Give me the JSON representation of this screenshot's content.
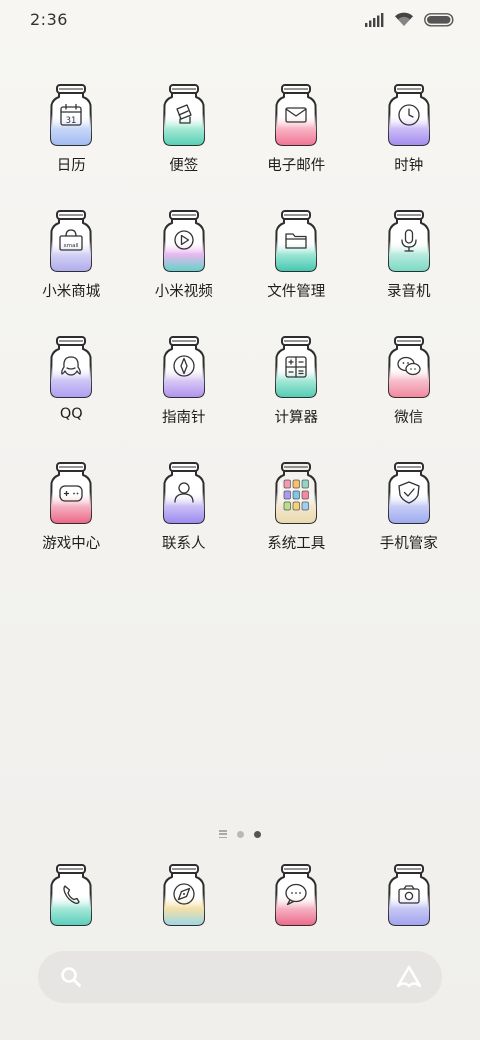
{
  "status_bar": {
    "time": "2:36"
  },
  "apps": [
    {
      "label": "日历",
      "icon": "calendar-icon",
      "glyph": "cal",
      "liquid": [
        "#ffffff",
        "#c8d8f8",
        "#9cb6f2"
      ]
    },
    {
      "label": "便签",
      "icon": "note-icon",
      "glyph": "note",
      "liquid": [
        "#ffffff",
        "#a9ead6",
        "#4ccbb0"
      ]
    },
    {
      "label": "电子邮件",
      "icon": "mail-icon",
      "glyph": "mail",
      "liquid": [
        "#ffffff",
        "#f8b5c6",
        "#f06a8c"
      ]
    },
    {
      "label": "时钟",
      "icon": "clock-icon",
      "glyph": "clock",
      "liquid": [
        "#ffffff",
        "#cdbff6",
        "#9c84ee"
      ]
    },
    {
      "label": "小米商城",
      "icon": "mall-icon",
      "glyph": "mall",
      "liquid": [
        "#ffffff",
        "#d4d2f5",
        "#aaa6ec"
      ]
    },
    {
      "label": "小米视频",
      "icon": "video-icon",
      "glyph": "video",
      "liquid": [
        "#ffffff",
        "#e9b8f0",
        "#4dd6c0"
      ]
    },
    {
      "label": "文件管理",
      "icon": "folder-icon",
      "glyph": "folder",
      "liquid": [
        "#ffffff",
        "#9fe6d7",
        "#34c2a8"
      ]
    },
    {
      "label": "录音机",
      "icon": "microphone-icon",
      "glyph": "mic",
      "liquid": [
        "#ffffff",
        "#b9eadf",
        "#6fd8bd"
      ]
    },
    {
      "label": "QQ",
      "icon": "qq-penguin-icon",
      "glyph": "qq",
      "liquid": [
        "#ffffff",
        "#cfc6f6",
        "#a899f0"
      ]
    },
    {
      "label": "指南针",
      "icon": "compass-icon",
      "glyph": "compass",
      "liquid": [
        "#ffffff",
        "#d9c9f4",
        "#a98aef"
      ]
    },
    {
      "label": "计算器",
      "icon": "calculator-icon",
      "glyph": "calc",
      "liquid": [
        "#ffffff",
        "#a7e8d8",
        "#45c7ad"
      ]
    },
    {
      "label": "微信",
      "icon": "wechat-icon",
      "glyph": "wechat",
      "liquid": [
        "#ffffff",
        "#f7c0cc",
        "#ef7e98"
      ]
    },
    {
      "label": "游戏中心",
      "icon": "gamepad-icon",
      "glyph": "game",
      "liquid": [
        "#ffffff",
        "#f4b2c2",
        "#ec5a7e"
      ]
    },
    {
      "label": "联系人",
      "icon": "contact-icon",
      "glyph": "contact",
      "liquid": [
        "#ffffff",
        "#c9bff5",
        "#9682ee"
      ]
    },
    {
      "label": "系统工具",
      "icon": "folder-system-tools-icon",
      "glyph": "folder-grid",
      "liquid": [
        "#ffffff",
        "#f2e6d0",
        "#e8d9a8"
      ]
    },
    {
      "label": "手机管家",
      "icon": "shield-icon",
      "glyph": "shield",
      "liquid": [
        "#ffffff",
        "#c6cdf6",
        "#98a4ee"
      ]
    }
  ],
  "dock": [
    {
      "icon": "phone-icon",
      "glyph": "phone",
      "liquid": [
        "#ffffff",
        "#a7e8da",
        "#4fcab5"
      ]
    },
    {
      "icon": "browser-compass-icon",
      "glyph": "browser",
      "liquid": [
        "#ffffff",
        "#f6e0a8",
        "#8ed5f0"
      ]
    },
    {
      "icon": "message-icon",
      "glyph": "msg",
      "liquid": [
        "#ffffff",
        "#f4b4c4",
        "#ec5e82"
      ]
    },
    {
      "icon": "camera-icon",
      "glyph": "camera",
      "liquid": [
        "#ffffff",
        "#c7c8f4",
        "#9b9eef"
      ]
    }
  ],
  "search": {
    "placeholder": ""
  },
  "calendar_day": "31",
  "mall_text": "xmall"
}
